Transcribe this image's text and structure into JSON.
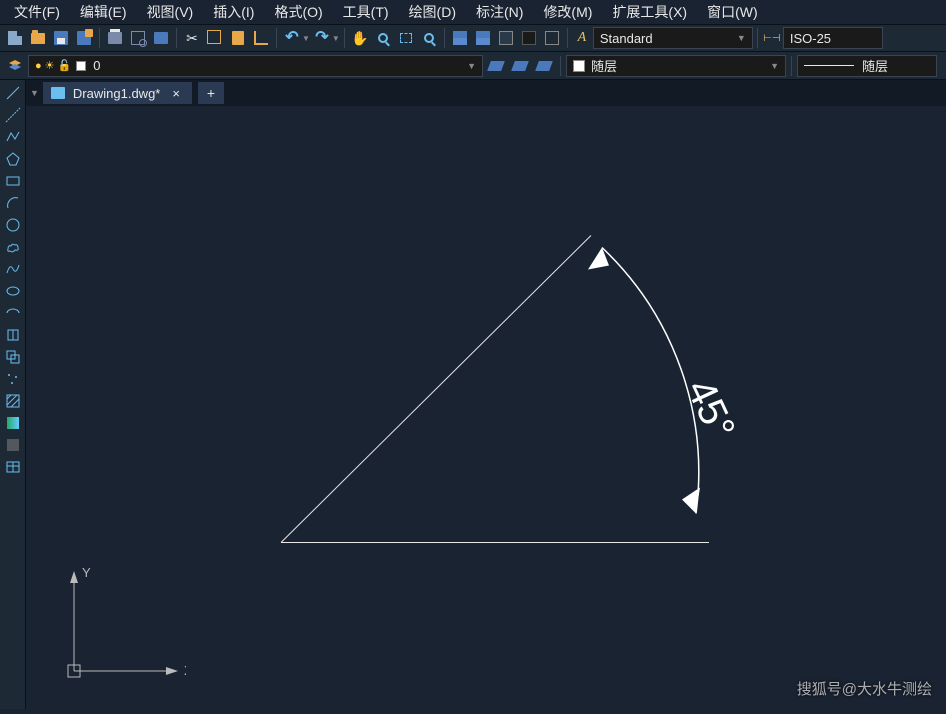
{
  "menu": {
    "file": "文件(F)",
    "edit": "编辑(E)",
    "view": "视图(V)",
    "insert": "插入(I)",
    "format": "格式(O)",
    "tools": "工具(T)",
    "draw": "绘图(D)",
    "dimension": "标注(N)",
    "modify": "修改(M)",
    "express": "扩展工具(X)",
    "window": "窗口(W)"
  },
  "layer": {
    "name": "0"
  },
  "style": {
    "current": "Standard"
  },
  "dimstyle": {
    "current": "ISO-25"
  },
  "bylayer1": "随层",
  "bylayer2": "随层",
  "tab": {
    "title": "Drawing1.dwg*"
  },
  "drawing": {
    "angle_label": "45°",
    "axes": {
      "x": "X",
      "y": "Y"
    }
  },
  "watermark": "搜狐号@大水牛测绘"
}
